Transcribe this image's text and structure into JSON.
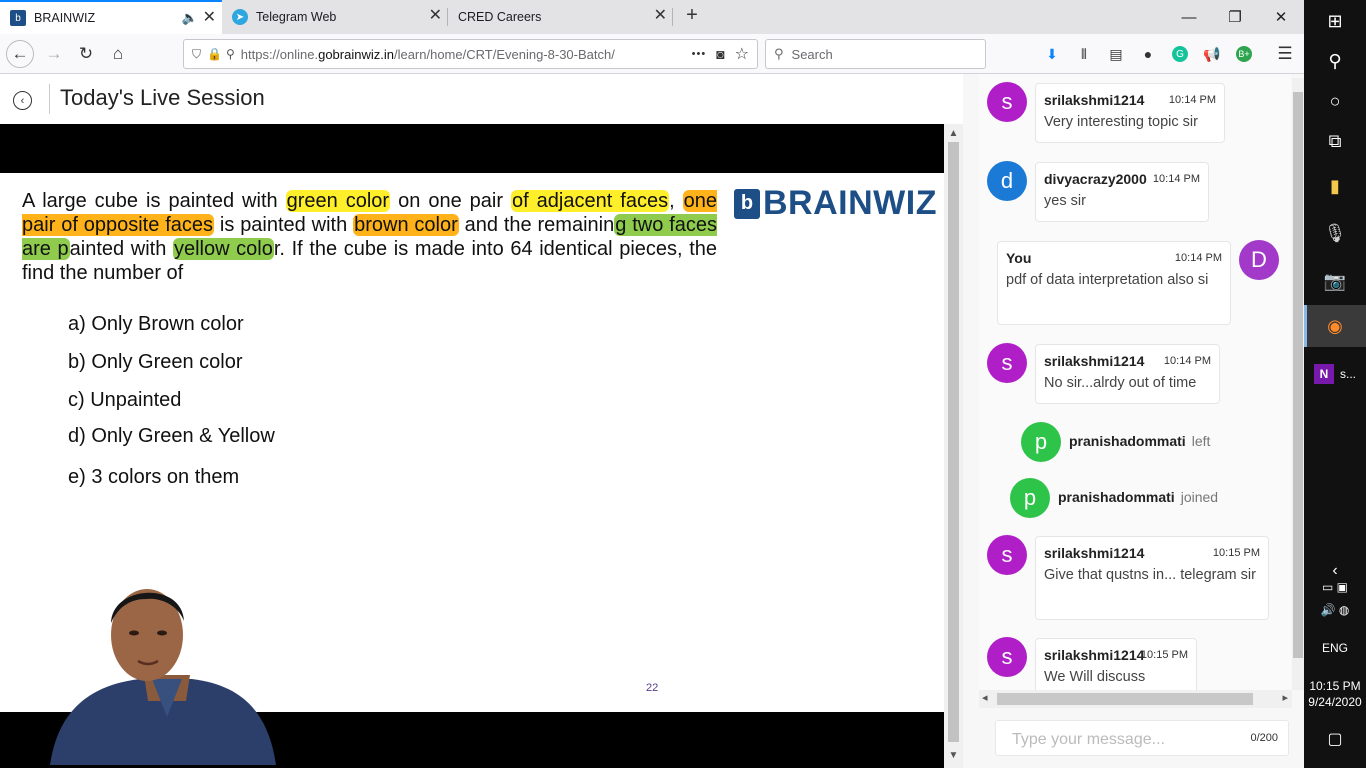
{
  "browser": {
    "tabs": [
      {
        "title": "BRAINWIZ",
        "active": true,
        "muted_icon": "speaker-icon"
      },
      {
        "title": "Telegram Web",
        "active": false
      },
      {
        "title": "CRED Careers",
        "active": false
      }
    ],
    "new_tab": "+",
    "url_prefix": "https://online.",
    "url_domain": "gobrainwiz.in",
    "url_rest": "/learn/home/CRT/Evening-8-30-Batch/",
    "search_placeholder": "Search",
    "menu_dots": "•••"
  },
  "page": {
    "title": "Today's Live Session"
  },
  "slide": {
    "question": {
      "t1": "A large cube is painted with ",
      "h1": "green color",
      "t2": " on one pair ",
      "h2": "of adjacent faces",
      "t3": ", ",
      "h3": "one pair of opposite faces",
      "t4": " is painted with ",
      "h4": "brown color",
      "t5": " and the remainin",
      "h5": "g two faces are p",
      "t6": "ainted with ",
      "h6": "yellow colo",
      "t7": "r. If the cube is made into 64 identical pieces, the find the number of"
    },
    "logo": {
      "mark": "b",
      "word": "BRAINWIZ"
    },
    "options": [
      "a) Only Brown color",
      "b) Only Green color",
      "c) Unpainted",
      "d) Only Green & Yellow",
      "e) 3 colors on them"
    ],
    "slide_number": "22"
  },
  "chat": {
    "messages": [
      {
        "avatar": "s",
        "user": "srilakshmi1214",
        "time": "10:14 PM",
        "text": "Very interesting topic sir",
        "color": "#b01ec8"
      },
      {
        "avatar": "d",
        "user": "divyacrazy2000",
        "time": "10:14 PM",
        "text": "yes sir",
        "color": "#1a7ad6"
      },
      {
        "avatar": "D",
        "user": "You",
        "time": "10:14 PM",
        "text": "pdf of data interpretation also si",
        "color": "#a239c9"
      },
      {
        "avatar": "s",
        "user": "srilakshmi1214",
        "time": "10:14 PM",
        "text": "No sir...alrdy out of time",
        "color": "#b01ec8"
      },
      {
        "avatar": "s",
        "user": "srilakshmi1214",
        "time": "10:15 PM",
        "text": "Give that qustns in... telegram sir",
        "color": "#b01ec8"
      },
      {
        "avatar": "s",
        "user": "srilakshmi1214",
        "time": "10:15 PM",
        "text": "We Will discuss",
        "color": "#b01ec8"
      }
    ],
    "events": [
      {
        "avatar": "p",
        "user": "pranishadommati",
        "action": "left",
        "color": "#2ec44a"
      },
      {
        "avatar": "p",
        "user": "pranishadommati",
        "action": "joined",
        "color": "#2ec44a"
      }
    ],
    "input_placeholder": "Type your message...",
    "char_counter": "0/200"
  },
  "taskbar": {
    "onenote_label": "s...",
    "language": "ENG",
    "time": "10:15 PM",
    "date": "9/24/2020"
  }
}
